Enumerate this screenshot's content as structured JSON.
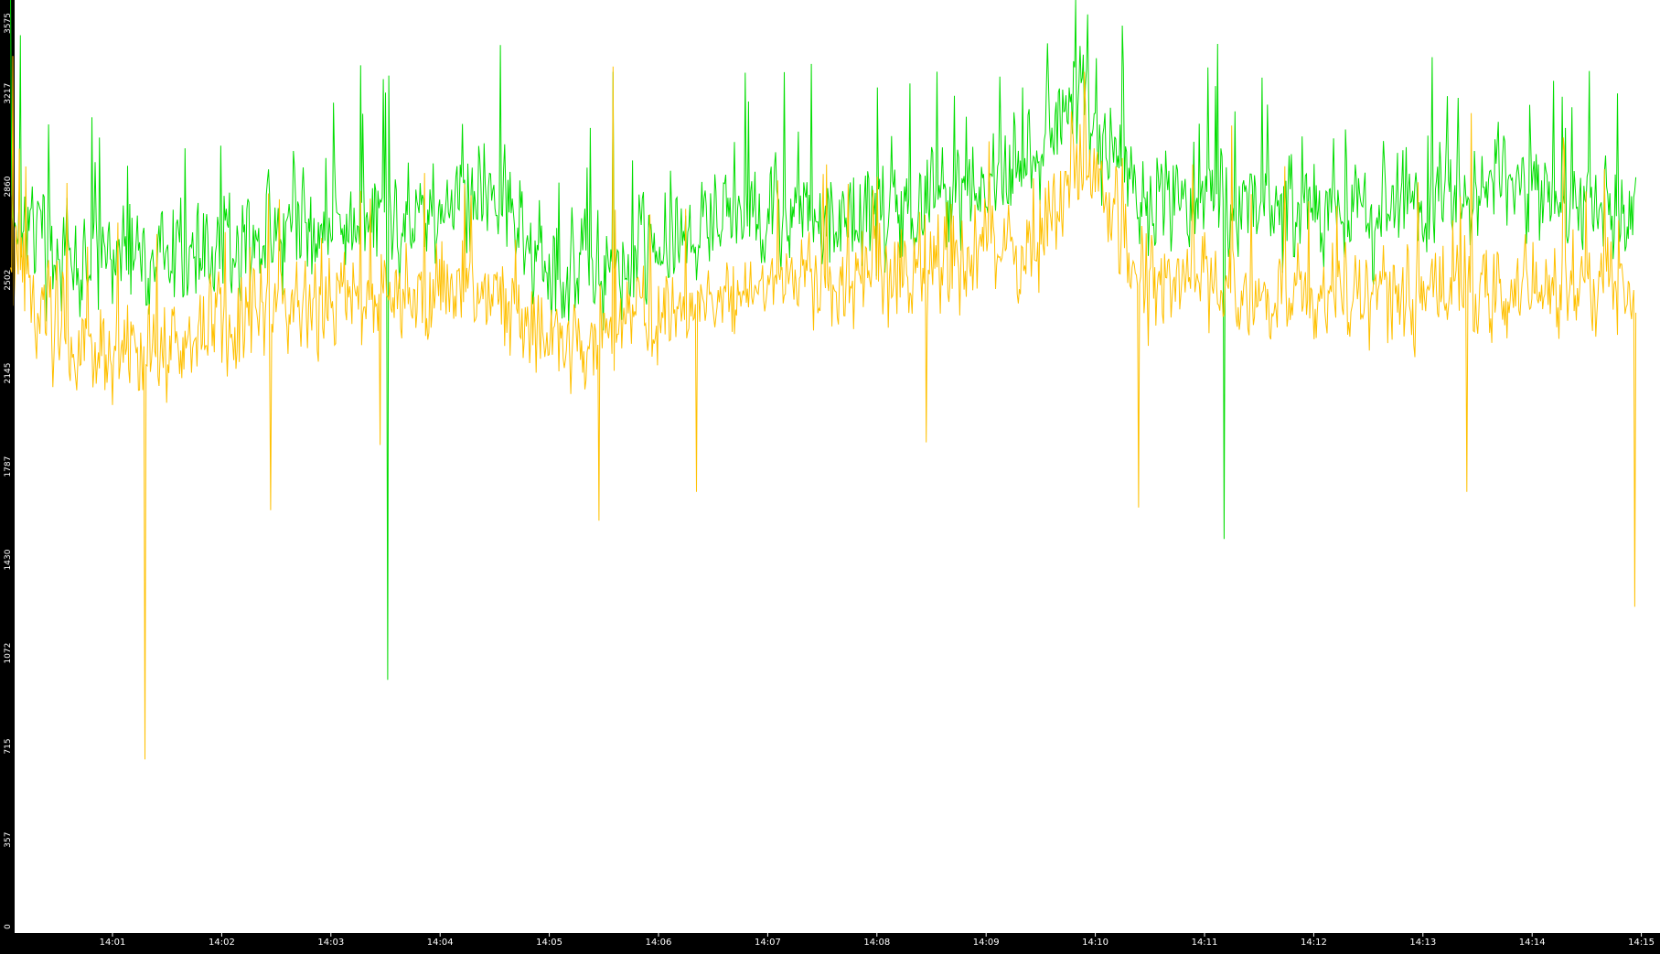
{
  "chart_data": {
    "type": "line",
    "title": "",
    "xlabel": "",
    "ylabel": "",
    "ylim": [
      0,
      3575
    ],
    "y_ticks": [
      "0",
      "357",
      "715",
      "1072",
      "1430",
      "1787",
      "2145",
      "2502",
      "2860",
      "3217",
      "3575"
    ],
    "x_ticks": [
      "14:01",
      "14:02",
      "14:03",
      "14:04",
      "14:05",
      "14:06",
      "14:07",
      "14:08",
      "14:09",
      "14:10",
      "14:11",
      "14:12",
      "14:13",
      "14:14",
      "14:15"
    ],
    "x_range": [
      "14:00:04",
      "14:15:00"
    ],
    "grid": false,
    "legend": "none",
    "background_color": "#ffffff",
    "axis_color": "#000000",
    "label_color": "#ffffff",
    "series": [
      {
        "color": "#00dd00",
        "baseline": [
          [
            0,
            2820
          ],
          [
            0.6,
            2560
          ],
          [
            1.5,
            2590
          ],
          [
            2.5,
            2680
          ],
          [
            3.5,
            2740
          ],
          [
            4.5,
            2830
          ],
          [
            5.0,
            2520
          ],
          [
            5.7,
            2590
          ],
          [
            6.6,
            2760
          ],
          [
            7.5,
            2730
          ],
          [
            8.5,
            2780
          ],
          [
            9.4,
            2980
          ],
          [
            9.9,
            3180
          ],
          [
            10.4,
            2820
          ],
          [
            11.5,
            2800
          ],
          [
            12.6,
            2760
          ],
          [
            13.6,
            2860
          ],
          [
            14.94,
            2740
          ]
        ],
        "noise": 130,
        "spikes": [
          {
            "t": 0.06,
            "v": 3575
          },
          {
            "t": 0.16,
            "v": 3440
          },
          {
            "t": 3.5,
            "v": 1640
          },
          {
            "t": 3.52,
            "v": 970
          },
          {
            "t": 3.5,
            "v": 3220
          },
          {
            "t": 4.2,
            "v": 3100
          },
          {
            "t": 5.58,
            "v": 3300
          },
          {
            "t": 7.4,
            "v": 3330
          },
          {
            "t": 8.0,
            "v": 3240
          },
          {
            "t": 9.33,
            "v": 3240
          },
          {
            "t": 9.93,
            "v": 3520
          },
          {
            "t": 11.18,
            "v": 1510
          },
          {
            "t": 13.32,
            "v": 3200
          }
        ]
      },
      {
        "color": "#ffc000",
        "baseline": [
          [
            0,
            2620
          ],
          [
            0.6,
            2250
          ],
          [
            1.5,
            2230
          ],
          [
            2.5,
            2410
          ],
          [
            3.5,
            2440
          ],
          [
            4.5,
            2480
          ],
          [
            5.0,
            2230
          ],
          [
            5.6,
            2300
          ],
          [
            6.5,
            2440
          ],
          [
            7.5,
            2510
          ],
          [
            8.5,
            2540
          ],
          [
            9.4,
            2620
          ],
          [
            9.9,
            3000
          ],
          [
            10.4,
            2520
          ],
          [
            11.5,
            2450
          ],
          [
            12.6,
            2420
          ],
          [
            13.6,
            2480
          ],
          [
            14.94,
            2470
          ]
        ],
        "noise": 120,
        "spikes": [
          {
            "t": 0.09,
            "v": 3360
          },
          {
            "t": 1.28,
            "v": 2080
          },
          {
            "t": 1.3,
            "v": 665
          },
          {
            "t": 2.45,
            "v": 1620
          },
          {
            "t": 3.45,
            "v": 1870
          },
          {
            "t": 5.45,
            "v": 1580
          },
          {
            "t": 5.58,
            "v": 3320
          },
          {
            "t": 6.35,
            "v": 1690
          },
          {
            "t": 7.5,
            "v": 2720
          },
          {
            "t": 8.45,
            "v": 1880
          },
          {
            "t": 9.9,
            "v": 3300
          },
          {
            "t": 10.4,
            "v": 1630
          },
          {
            "t": 13.4,
            "v": 1690
          },
          {
            "t": 14.94,
            "v": 1250
          }
        ]
      }
    ]
  }
}
